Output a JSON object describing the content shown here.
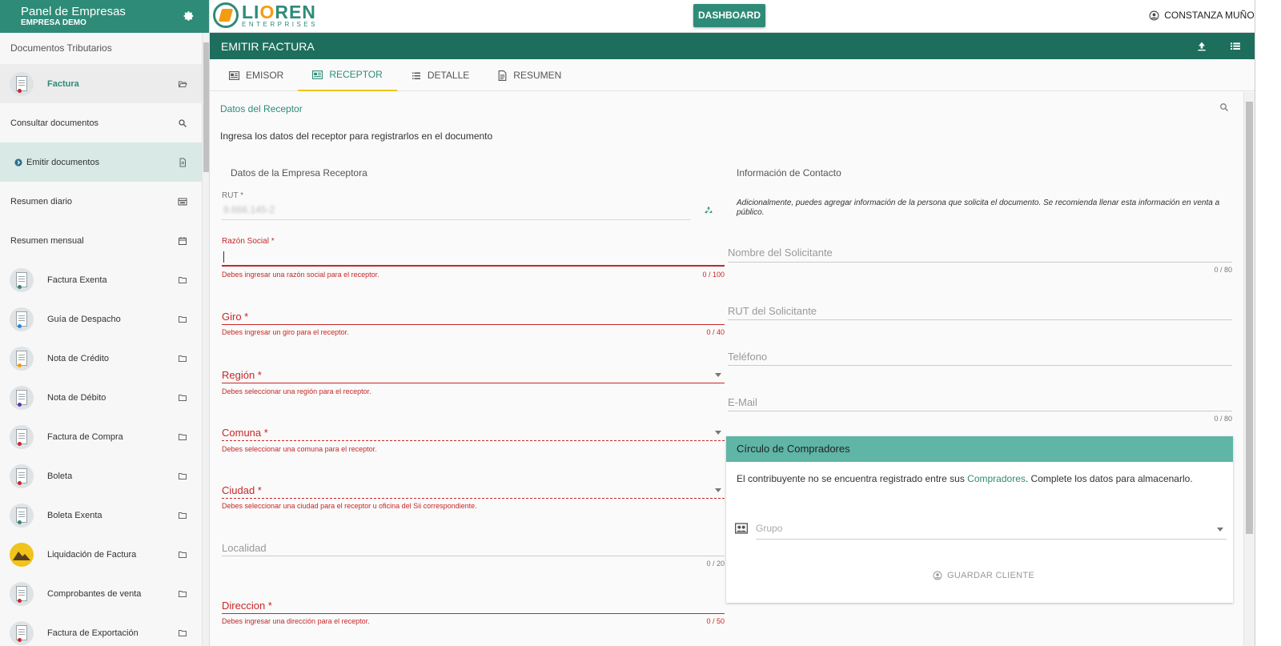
{
  "sidebar": {
    "title": "Panel de Empresas",
    "subtitle": "EMPRESA DEMO",
    "section": "Documentos Tributarios",
    "items": [
      {
        "label": "Factura",
        "dot": "#c62828"
      },
      {
        "label": "Consultar documentos"
      },
      {
        "label": "Emitir documentos"
      },
      {
        "label": "Resumen diario"
      },
      {
        "label": "Resumen mensual"
      },
      {
        "label": "Factura Exenta",
        "dot": "#2e8b77"
      },
      {
        "label": "Guía de Despacho",
        "dot": "#1e88e5"
      },
      {
        "label": "Nota de Crédito",
        "dot": "#f39c12"
      },
      {
        "label": "Nota de Débito",
        "dot": "#5e35b1"
      },
      {
        "label": "Factura de Compra",
        "dot": "#c62828"
      },
      {
        "label": "Boleta",
        "dot": "#c62828"
      },
      {
        "label": "Boleta Exenta",
        "dot": "#2e8b77"
      },
      {
        "label": "Liquidación de Factura",
        "dot": "#8d5524"
      },
      {
        "label": "Comprobantes de venta",
        "dot": "#c62828"
      },
      {
        "label": "Factura de Exportación",
        "dot": "#c62828"
      }
    ]
  },
  "topbar": {
    "logo_name_a": "LI",
    "logo_name_b": "O",
    "logo_name_c": "REN",
    "logo_sub": "ENTERPRISES",
    "dashboard_label": "DASHBOARD",
    "user_name": "CONSTANZA MUÑOZ"
  },
  "page": {
    "title": "EMITIR FACTURA",
    "tabs": [
      "EMISOR",
      "RECEPTOR",
      "DETALLE",
      "RESUMEN"
    ],
    "active_tab": "RECEPTOR"
  },
  "receptor": {
    "section_title": "Datos del Receptor",
    "intro": "Ingresa los datos del receptor para registrarlos en el documento",
    "company_heading": "Datos de la Empresa Receptora",
    "contact_heading": "Información de Contacto",
    "rut_label": "RUT *",
    "rut_value": "9.666.145-2",
    "razon_label": "Razón Social *",
    "razon_error": "Debes ingresar una razón social para el receptor.",
    "razon_count": "0 / 100",
    "giro_label": "Giro *",
    "giro_error": "Debes ingresar un giro para el receptor.",
    "giro_count": "0 / 40",
    "region_label": "Región *",
    "region_error": "Debes seleccionar una región para el receptor.",
    "comuna_label": "Comuna *",
    "comuna_error": "Debes seleccionar una comuna para el receptor.",
    "ciudad_label": "Ciudad *",
    "ciudad_error": "Debes seleccionar una ciudad para el receptor u oficina del Sii correspondiente.",
    "localidad_label": "Localidad",
    "localidad_count": "0 / 20",
    "direccion_label": "Direccion *",
    "direccion_error": "Debes ingresar una dirección para el receptor.",
    "direccion_count": "0 / 50"
  },
  "contact": {
    "note": "Adicionalmente, puedes agregar información de la persona que solicita el documento. Se recomienda llenar esta información en venta a público.",
    "nombre_label": "Nombre del Solicitante",
    "nombre_count": "0 / 80",
    "rut_label": "RUT del Solicitante",
    "telefono_label": "Teléfono",
    "email_label": "E-Mail",
    "email_count": "0 / 80"
  },
  "buyers_card": {
    "title": "Círculo de Compradores",
    "text_before": "El contribuyente no se encuentra registrado entre sus ",
    "link": "Compradores",
    "text_after": ". Complete los datos para almacenarlo.",
    "grupo_placeholder": "Grupo",
    "save_label": "GUARDAR CLIENTE"
  },
  "colors": {
    "brand": "#2e8b77",
    "accent": "#f39c12",
    "error": "#c62828",
    "tab_indicator": "#f0c419"
  }
}
